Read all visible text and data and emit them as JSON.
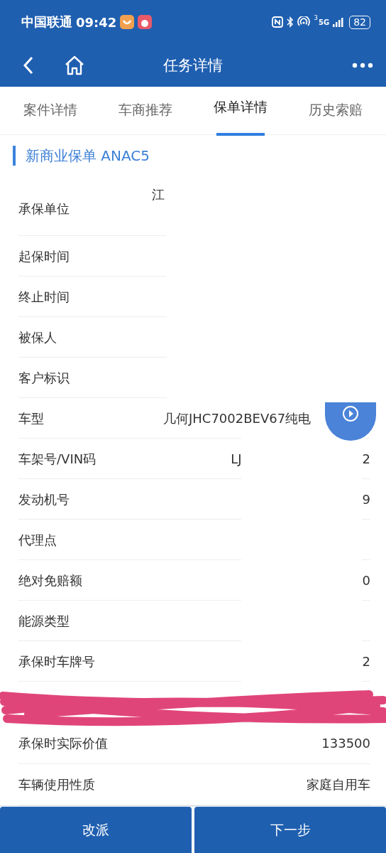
{
  "status_bar": {
    "carrier": "中国联通",
    "time": "09:42",
    "network": "5G",
    "sim": "3",
    "battery": "82"
  },
  "header": {
    "title": "任务详情"
  },
  "tabs": [
    {
      "label": "案件详情",
      "selected": false
    },
    {
      "label": "车商推荐",
      "selected": false
    },
    {
      "label": "保单详情",
      "selected": true
    },
    {
      "label": "历史索赔",
      "selected": false
    }
  ],
  "section": {
    "title": "新商业保单 ANAC5"
  },
  "rows": [
    {
      "kind": "left",
      "label": "承保单位",
      "values": [
        "江"
      ],
      "tall": true
    },
    {
      "kind": "empty",
      "label": "起保时间",
      "values": []
    },
    {
      "kind": "empty",
      "label": "终止时间",
      "values": []
    },
    {
      "kind": "empty",
      "label": "被保人",
      "values": []
    },
    {
      "kind": "empty",
      "label": "客户标识",
      "values": []
    },
    {
      "kind": "left",
      "label": "车型",
      "values": [
        "几何JHC7002BEV67纯电"
      ]
    },
    {
      "kind": "split",
      "label": "车架号/VIN码",
      "values": [
        "LJ",
        "2"
      ]
    },
    {
      "kind": "right",
      "label": "发动机号",
      "values": [
        "9"
      ]
    },
    {
      "kind": "empty",
      "label": "代理点",
      "values": []
    },
    {
      "kind": "right",
      "label": "绝对免赔额",
      "values": [
        "0"
      ]
    },
    {
      "kind": "empty",
      "label": "能源类型",
      "values": []
    },
    {
      "kind": "right",
      "label": "承保时车牌号",
      "values": [
        "2"
      ]
    },
    {
      "kind": "redacted",
      "label": "",
      "values": []
    },
    {
      "kind": "right",
      "label": "承保时实际价值",
      "values": [
        "133500"
      ]
    },
    {
      "kind": "right",
      "label": "车辆使用性质",
      "values": [
        "家庭自用车"
      ]
    }
  ],
  "buttons": [
    "改派",
    "下一步"
  ]
}
